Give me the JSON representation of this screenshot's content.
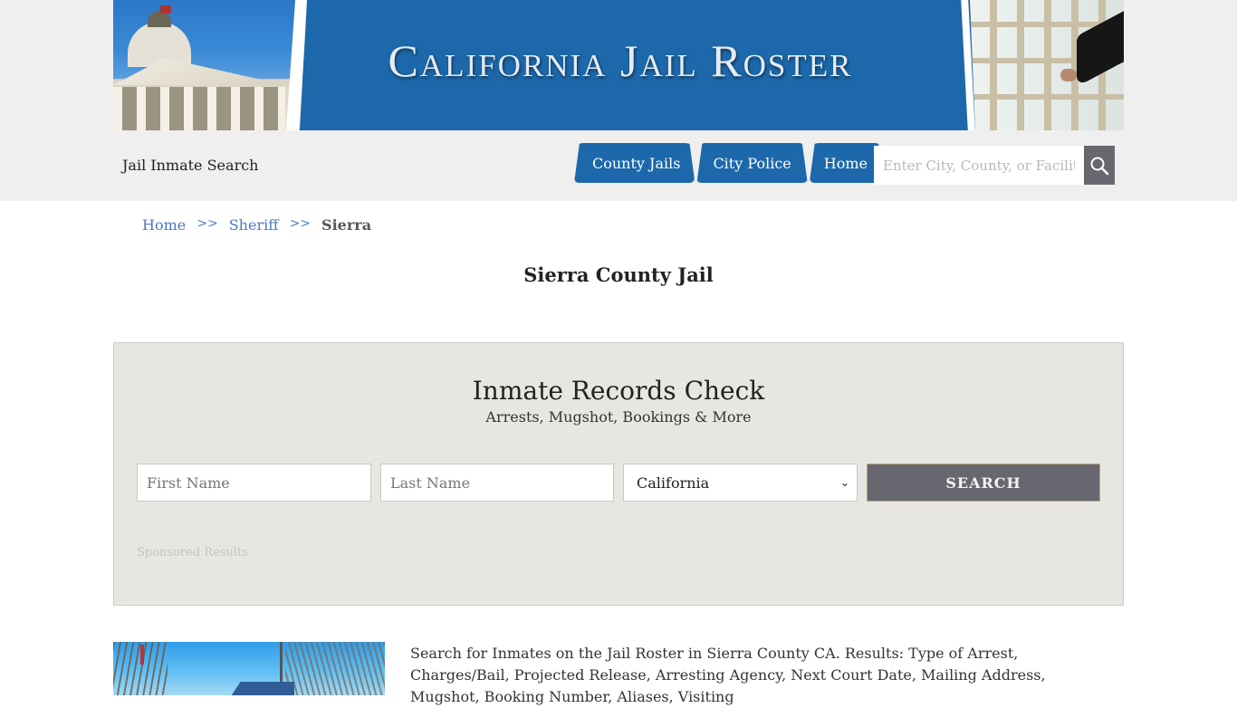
{
  "header": {
    "banner_title": "California Jail Roster",
    "site_name": "Jail Inmate Search",
    "nav": [
      {
        "label": "County Jails"
      },
      {
        "label": "City Police"
      },
      {
        "label": "Home"
      }
    ],
    "search": {
      "placeholder": "Enter City, County, or Facility",
      "value": "",
      "icon": "magnifier-icon"
    }
  },
  "breadcrumb": {
    "items": [
      {
        "label": "Home"
      },
      {
        "label": "Sheriff"
      }
    ],
    "separator": ">>",
    "current": "Sierra"
  },
  "page": {
    "title": "Sierra County Jail"
  },
  "records_check": {
    "title": "Inmate Records Check",
    "subtitle": "Arrests, Mugshot, Bookings & More",
    "first_name_placeholder": "First Name",
    "last_name_placeholder": "Last Name",
    "state_selected": "California",
    "search_label": "SEARCH",
    "sponsored_label": "Sponsored Results"
  },
  "content": {
    "description": "Search for Inmates on the Jail Roster in Sierra County CA. Results: Type of Arrest, Charges/Bail, Projected Release, Arresting Agency, Next Court Date, Mailing Address, Mugshot, Booking Number, Aliases, Visiting"
  },
  "colors": {
    "brand_blue": "#1c68aa",
    "search_button": "#66676f",
    "link": "#4a77c9",
    "records_bg": "#e8e6e1"
  }
}
